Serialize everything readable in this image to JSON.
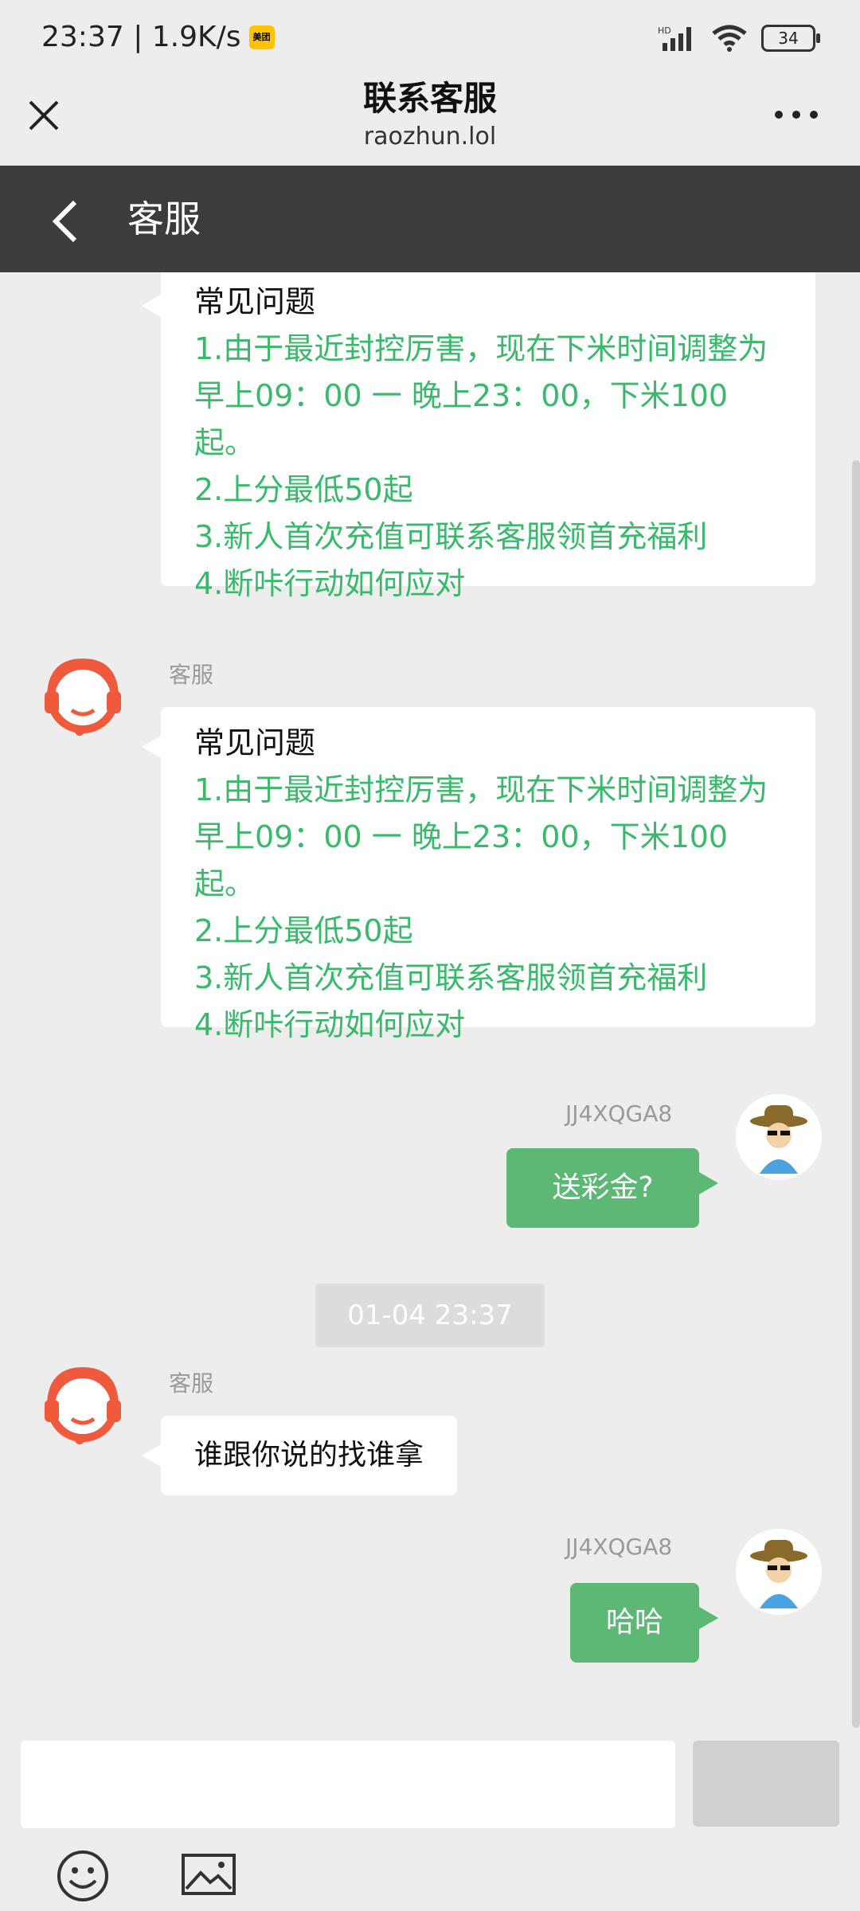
{
  "status": {
    "time": "23:37 | 1.9K/s",
    "app_badge": "美团",
    "network_label": "HD",
    "battery": "34"
  },
  "header": {
    "title": "联系客服",
    "subtitle": "raozhun.lol"
  },
  "nav": {
    "title": "客服"
  },
  "messages": {
    "faq_title": "常见问题",
    "faq_lines": [
      "1.由于最近封控厉害，现在下米时间调整为",
      "早上09：00 一 晚上23：00，下米100",
      "起。",
      "2.上分最低50起",
      "3.新人首次充值可联系客服领首充福利",
      "4.断咔行动如何应对"
    ],
    "agent_name": "客服",
    "user_name": "JJ4XQGA8",
    "user_msg_1": "送彩金?",
    "timestamp": "01-04 23:37",
    "agent_reply": "谁跟你说的找谁拿",
    "user_msg_2": "哈哈"
  },
  "colors": {
    "user_bubble": "#5cb874",
    "faq_text": "#39b96a",
    "nav_bg": "#3b3c3e",
    "agent_avatar": "#f05a3c"
  },
  "icons": [
    "close-icon",
    "more-icon",
    "back-icon",
    "headset-agent-icon",
    "user-avatar-icon",
    "emoji-icon",
    "image-icon"
  ]
}
